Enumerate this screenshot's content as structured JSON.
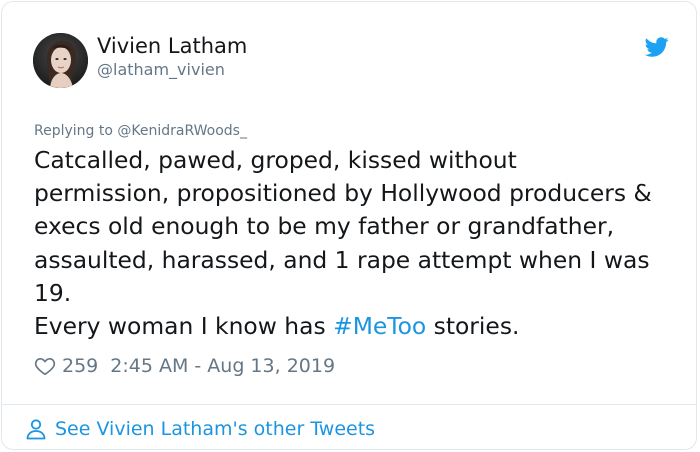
{
  "user": {
    "name": "Vivien Latham",
    "handle": "@latham_vivien"
  },
  "tweet": {
    "replying_to": "Replying to @KenidraRWoods_",
    "lines": [
      "Catcalled, pawed, groped, kissed without",
      "permission, propositioned by Hollywood producers &",
      "execs old enough to be my father or grandfather,",
      "assaulted, harassed, and 1 rape attempt when I was",
      "19."
    ],
    "last_line_before": "Every woman I know has ",
    "hashtag": "#MeToo",
    "last_line_after": " stories."
  },
  "meta": {
    "likes": "259",
    "timestamp": "2:45 AM - Aug 13, 2019"
  },
  "footer": {
    "link_label": "See Vivien Latham's other Tweets"
  },
  "icons": {
    "brand": "twitter-bird-icon",
    "like": "heart-icon",
    "profile": "person-icon"
  },
  "colors": {
    "link": "#1b95e0",
    "secondary_text": "#657786",
    "brand": "#1da1f2"
  }
}
